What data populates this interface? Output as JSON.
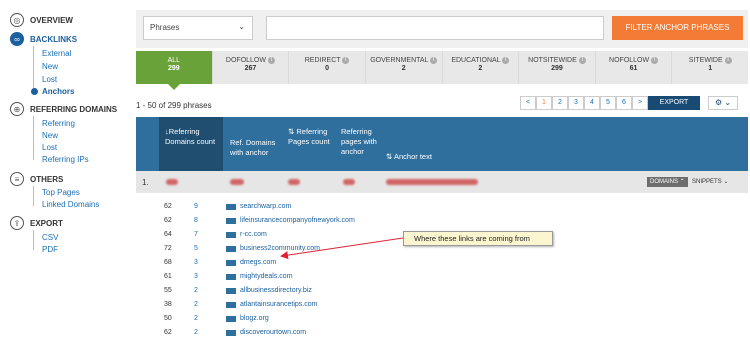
{
  "sidebar": {
    "overview": "OVERVIEW",
    "backlinks": "BACKLINKS",
    "backlinks_items": [
      "External",
      "New",
      "Lost",
      "Anchors"
    ],
    "referring": "REFERRING DOMAINS",
    "referring_items": [
      "Referring",
      "New",
      "Lost",
      "Referring IPs"
    ],
    "others": "OTHERS",
    "others_items": [
      "Top Pages",
      "Linked Domains"
    ],
    "export": "EXPORT",
    "export_items": [
      "CSV",
      "PDF"
    ]
  },
  "toolbar": {
    "select_value": "Phrases",
    "search_value": "",
    "filter_label": "FILTER ANCHOR PHRASES"
  },
  "tabs": [
    {
      "label": "ALL",
      "count": "299"
    },
    {
      "label": "DOFOLLOW",
      "count": "267"
    },
    {
      "label": "REDIRECT",
      "count": "0"
    },
    {
      "label": "GOVERNMENTAL",
      "count": "2"
    },
    {
      "label": "EDUCATIONAL",
      "count": "2"
    },
    {
      "label": "NOTSITEWIDE",
      "count": "299"
    },
    {
      "label": "NOFOLLOW",
      "count": "61"
    },
    {
      "label": "SITEWIDE",
      "count": "1"
    }
  ],
  "results": {
    "range": "1 - 50 of 299 phrases",
    "pages": [
      "<",
      "1",
      "2",
      "3",
      "4",
      "5",
      "6",
      ">"
    ],
    "export_label": "EXPORT"
  },
  "columns": {
    "ref_domains_count": "Referring Domains count",
    "ref_domains_anchor": "Ref. Domains with anchor",
    "ref_pages_count": "Referring Pages count",
    "ref_pages_anchor": "Referring pages with anchor",
    "anchor_text": "Anchor text"
  },
  "row1": {
    "num": "1.",
    "domains_btn": "DOMAINS",
    "snippets_btn": "SNIPPETS"
  },
  "domains": [
    {
      "a": "62",
      "b": "9",
      "domain": "searchwarp.com"
    },
    {
      "a": "62",
      "b": "8",
      "domain": "lifeinsurancecompanyofnewyork.com"
    },
    {
      "a": "64",
      "b": "7",
      "domain": "r-cc.com"
    },
    {
      "a": "72",
      "b": "5",
      "domain": "business2community.com"
    },
    {
      "a": "68",
      "b": "3",
      "domain": "dmegs.com"
    },
    {
      "a": "61",
      "b": "3",
      "domain": "mightydeals.com"
    },
    {
      "a": "55",
      "b": "2",
      "domain": "allbusinessdirectory.biz"
    },
    {
      "a": "38",
      "b": "2",
      "domain": "atlantainsurancetips.com"
    },
    {
      "a": "50",
      "b": "2",
      "domain": "blogz.org"
    },
    {
      "a": "62",
      "b": "2",
      "domain": "discoverourtown.com"
    }
  ],
  "annotation": "Where these links are coming from",
  "colors": {
    "accent": "#f47b35",
    "header": "#2f6f9e",
    "active_tab": "#6aa23a",
    "link": "#1a6fb8"
  }
}
